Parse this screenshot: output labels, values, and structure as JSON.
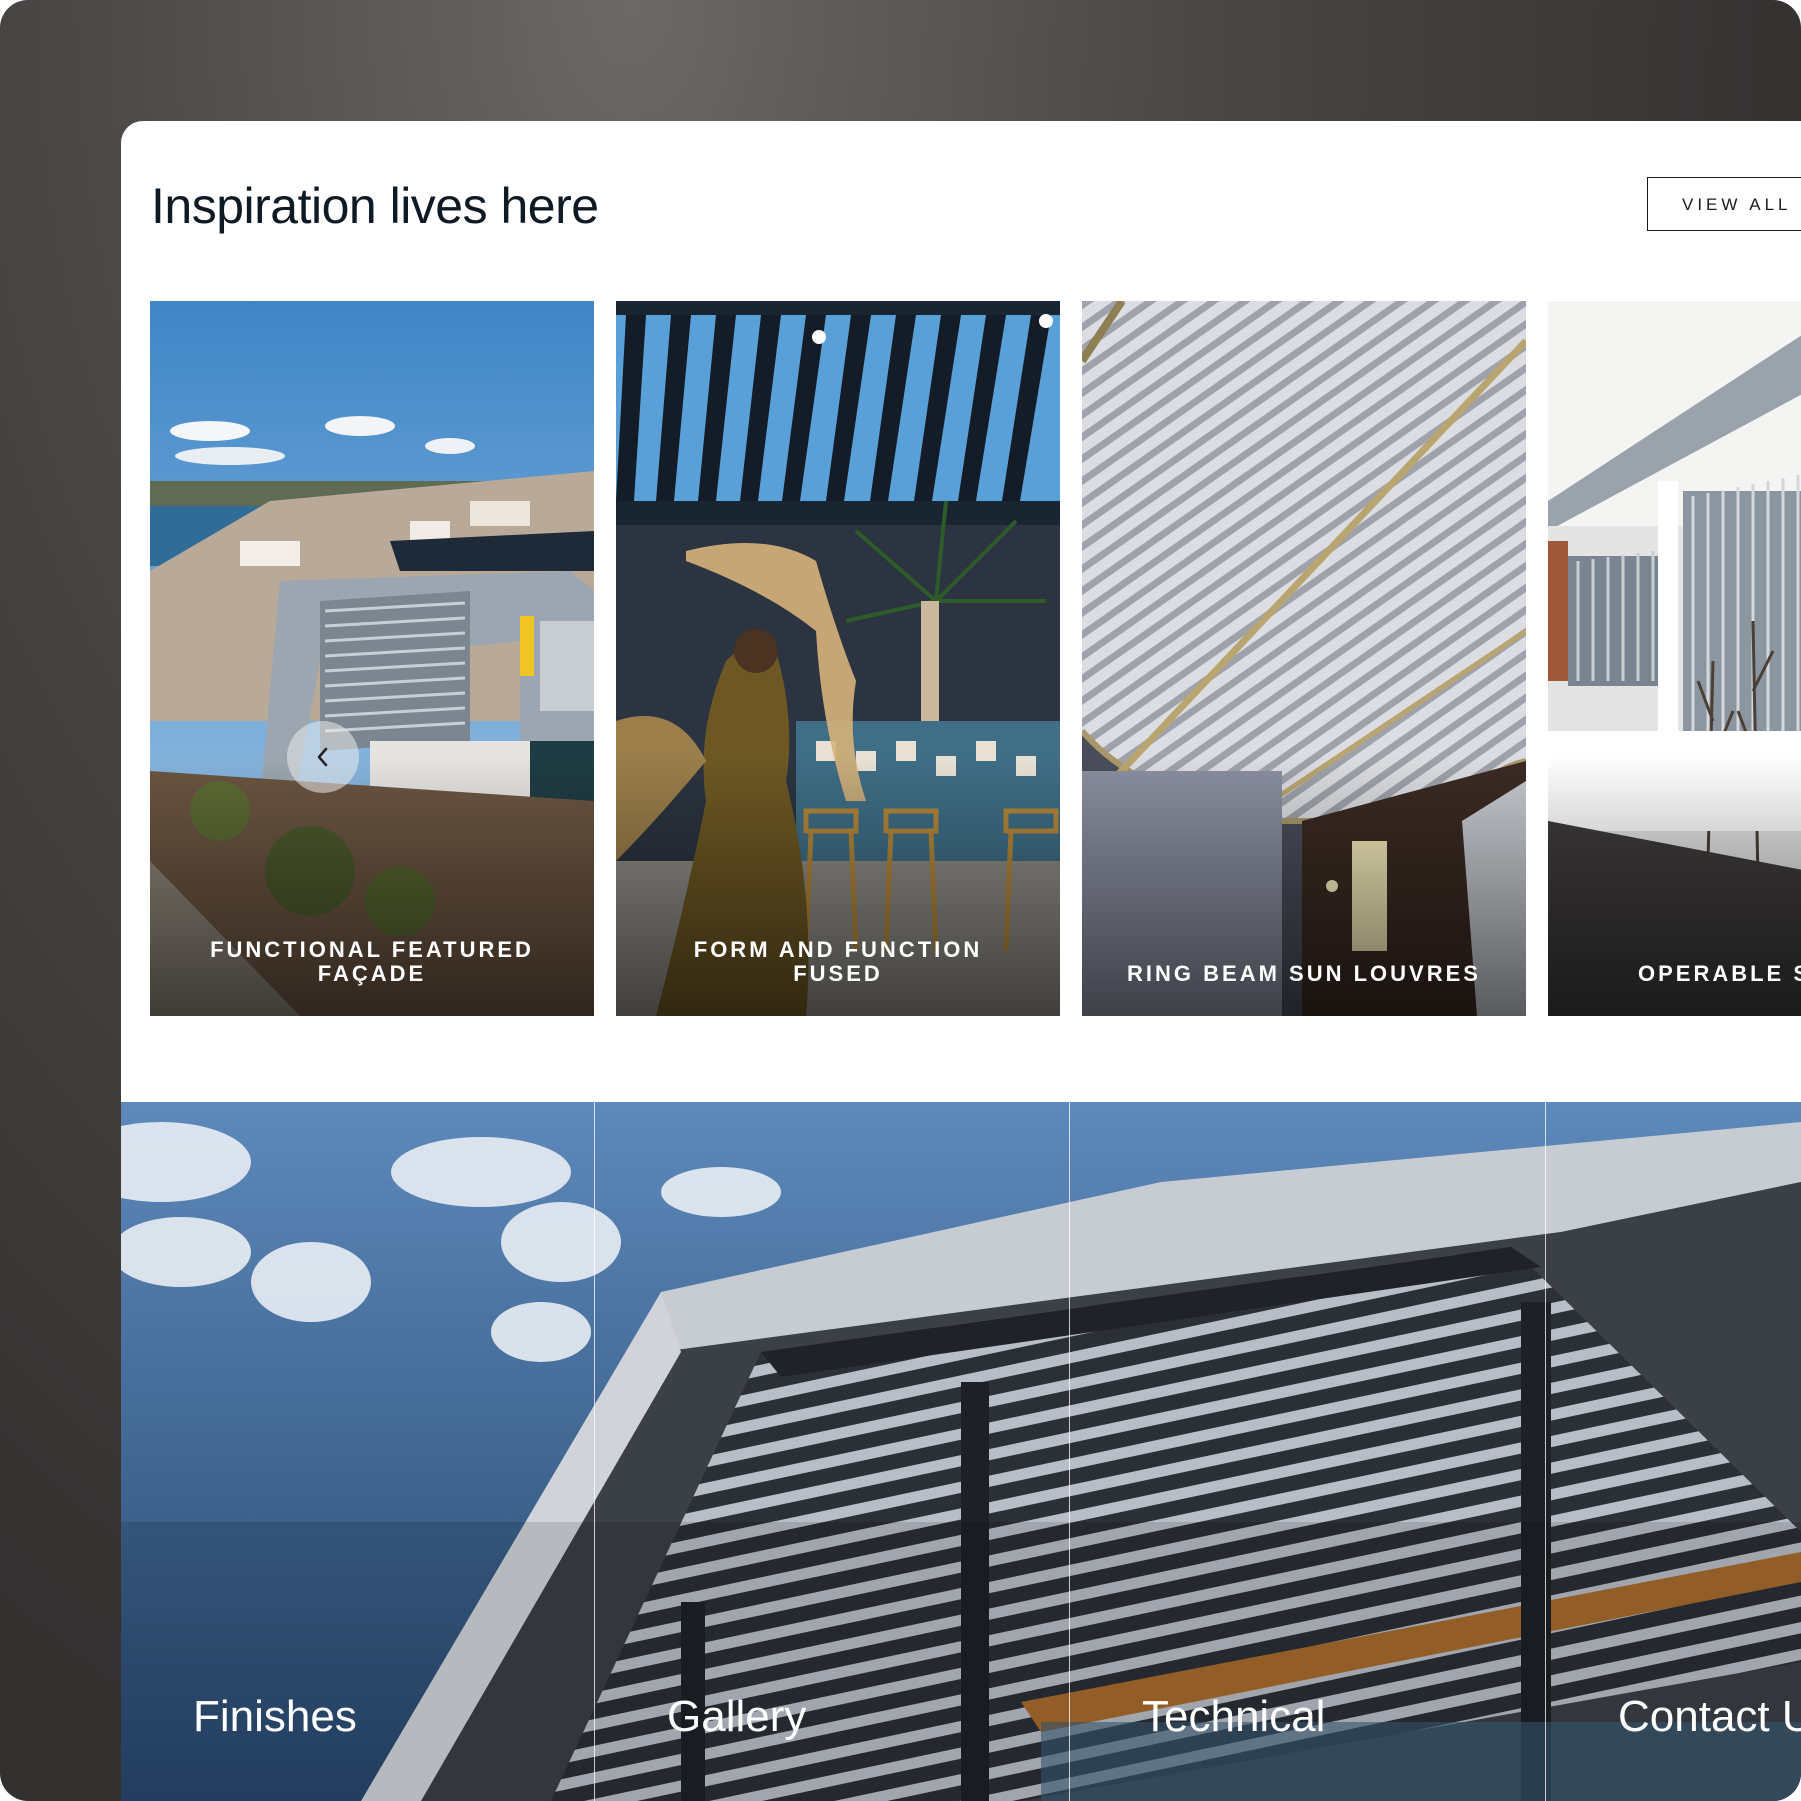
{
  "header": {
    "title": "Inspiration lives here",
    "view_all_label": "VIEW ALL"
  },
  "carousel": {
    "prev_icon": "chevron-left-icon",
    "cards": [
      {
        "label": "FUNCTIONAL FEATURED\nFAÇADE"
      },
      {
        "label": "FORM AND FUNCTION FUSED"
      },
      {
        "label": "RING BEAM SUN LOUVRES"
      },
      {
        "label": "OPERABLE SI"
      }
    ]
  },
  "bottom_nav": {
    "tiles": [
      {
        "label": "Finishes"
      },
      {
        "label": "Gallery"
      },
      {
        "label": "Technical"
      },
      {
        "label": "Contact U"
      }
    ]
  }
}
